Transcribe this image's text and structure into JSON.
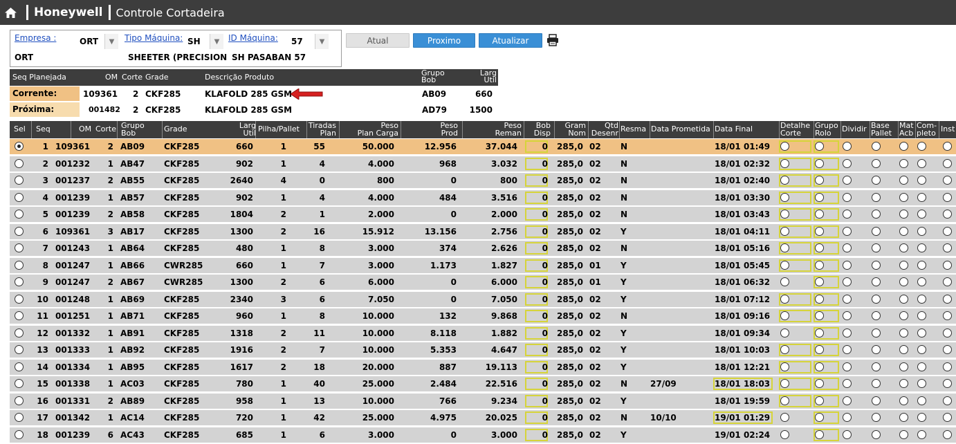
{
  "header": {
    "brand": "Honeywell",
    "title": "Controle Cortadeira"
  },
  "filters": {
    "empresa_label": "Empresa :",
    "empresa_value": "ORT",
    "empresa_text": "ORT",
    "tipo_label": "Tipo Máquina:",
    "tipo_value": "SH",
    "tipo_text": "SHEETER (PRECISION",
    "id_label": "ID Máquina:",
    "id_value": "57",
    "id_text": "SH PASABAN 57"
  },
  "buttons": {
    "atual": "Atual",
    "proximo": "Proximo",
    "atualizar": "Atualizar"
  },
  "info": {
    "headers": {
      "seq": "Seq Planejada",
      "om": "OM",
      "corte": "Corte",
      "grade": "Grade",
      "desc": "Descrição Produto",
      "grupo1": "Grupo",
      "grupo2": "Bob",
      "larg1": "Larg",
      "larg2": "Util"
    },
    "corrente": {
      "label": "Corrente:",
      "om": "109361",
      "corte": "2",
      "grade": "CKF285",
      "desc": "KLAFOLD 285 GSM",
      "grupo": "AB09",
      "larg": "660"
    },
    "proxima": {
      "label": "Próxima:",
      "om": "001482",
      "corte": "2",
      "grade": "CKF285",
      "desc": "KLAFOLD 285 GSM",
      "grupo": "AD79",
      "larg": "1500"
    }
  },
  "grid": {
    "headers": {
      "sel": "Sel",
      "seq": "Seq",
      "om": "OM",
      "corte": "Corte",
      "grupo1": "Grupo",
      "grupo2": "Bob",
      "grade": "Grade",
      "larg1": "Larg",
      "larg2": "Util",
      "pilha": "Pilha/Pallet",
      "tir1": "Tiradas",
      "tir2": "Plan",
      "pp1": "Peso",
      "pp2": "Plan Carga",
      "pprod1": "Peso",
      "pprod2": "Prod",
      "prem1": "Peso",
      "prem2": "Reman",
      "bob1": "Bob",
      "bob2": "Disp",
      "gram1": "Gram",
      "gram2": "Nom",
      "qtd1": "Qtd",
      "qtd2": "Desenr",
      "resma": "Resma",
      "dprom": "Data Prometida",
      "dfinal": "Data Final",
      "det1": "Detalhe",
      "det2": "Corte",
      "gr1": "Grupo",
      "gr2": "Rolo",
      "dividir": "Dividir",
      "base1": "Base",
      "base2": "Pallet",
      "mat1": "Mat",
      "mat2": "Acb",
      "comp1": "Com-",
      "comp2": "pleto",
      "inst": "Inst"
    },
    "rows": [
      {
        "seq": "1",
        "om": "109361",
        "corte": "2",
        "grupo": "AB09",
        "grade": "CKF285",
        "larg": "660",
        "pilha": "1",
        "tiradas": "55",
        "plan": "50.000",
        "prod": "12.956",
        "reman": "37.044",
        "bob": "0",
        "gram": "285,0",
        "qtd": "02",
        "resma": "N",
        "dprom": "",
        "dfinal": "18/01 01:49",
        "selected": true,
        "yb_final": false,
        "yb_det": true,
        "yb_grupo": true
      },
      {
        "seq": "2",
        "om": "001232",
        "corte": "1",
        "grupo": "AB47",
        "grade": "CKF285",
        "larg": "902",
        "pilha": "1",
        "tiradas": "4",
        "plan": "4.000",
        "prod": "968",
        "reman": "3.032",
        "bob": "0",
        "gram": "285,0",
        "qtd": "02",
        "resma": "N",
        "dprom": "",
        "dfinal": "18/01 02:32",
        "selected": false,
        "yb_final": false,
        "yb_det": true,
        "yb_grupo": true
      },
      {
        "seq": "3",
        "om": "001237",
        "corte": "2",
        "grupo": "AB55",
        "grade": "CKF285",
        "larg": "2640",
        "pilha": "4",
        "tiradas": "0",
        "plan": "800",
        "prod": "0",
        "reman": "800",
        "bob": "0",
        "gram": "285,0",
        "qtd": "02",
        "resma": "N",
        "dprom": "",
        "dfinal": "18/01 02:40",
        "selected": false,
        "yb_final": false,
        "yb_det": true,
        "yb_grupo": true
      },
      {
        "seq": "4",
        "om": "001239",
        "corte": "1",
        "grupo": "AB57",
        "grade": "CKF285",
        "larg": "902",
        "pilha": "1",
        "tiradas": "4",
        "plan": "4.000",
        "prod": "484",
        "reman": "3.516",
        "bob": "0",
        "gram": "285,0",
        "qtd": "02",
        "resma": "N",
        "dprom": "",
        "dfinal": "18/01 03:30",
        "selected": false,
        "yb_final": false,
        "yb_det": true,
        "yb_grupo": true
      },
      {
        "seq": "5",
        "om": "001239",
        "corte": "2",
        "grupo": "AB58",
        "grade": "CKF285",
        "larg": "1804",
        "pilha": "2",
        "tiradas": "1",
        "plan": "2.000",
        "prod": "0",
        "reman": "2.000",
        "bob": "0",
        "gram": "285,0",
        "qtd": "02",
        "resma": "N",
        "dprom": "",
        "dfinal": "18/01 03:43",
        "selected": false,
        "yb_final": false,
        "yb_det": true,
        "yb_grupo": true
      },
      {
        "seq": "6",
        "om": "109361",
        "corte": "3",
        "grupo": "AB17",
        "grade": "CKF285",
        "larg": "1300",
        "pilha": "2",
        "tiradas": "16",
        "plan": "15.912",
        "prod": "13.156",
        "reman": "2.756",
        "bob": "0",
        "gram": "285,0",
        "qtd": "02",
        "resma": "Y",
        "dprom": "",
        "dfinal": "18/01 04:11",
        "selected": false,
        "yb_final": false,
        "yb_det": true,
        "yb_grupo": true
      },
      {
        "seq": "7",
        "om": "001243",
        "corte": "1",
        "grupo": "AB64",
        "grade": "CKF285",
        "larg": "480",
        "pilha": "1",
        "tiradas": "8",
        "plan": "3.000",
        "prod": "374",
        "reman": "2.626",
        "bob": "0",
        "gram": "285,0",
        "qtd": "02",
        "resma": "N",
        "dprom": "",
        "dfinal": "18/01 05:16",
        "selected": false,
        "yb_final": false,
        "yb_det": true,
        "yb_grupo": true
      },
      {
        "seq": "8",
        "om": "001247",
        "corte": "1",
        "grupo": "AB66",
        "grade": "CWR285",
        "larg": "660",
        "pilha": "1",
        "tiradas": "7",
        "plan": "3.000",
        "prod": "1.173",
        "reman": "1.827",
        "bob": "0",
        "gram": "285,0",
        "qtd": "01",
        "resma": "Y",
        "dprom": "",
        "dfinal": "18/01 05:45",
        "selected": false,
        "yb_final": false,
        "yb_det": true,
        "yb_grupo": true
      },
      {
        "seq": "9",
        "om": "001247",
        "corte": "2",
        "grupo": "AB67",
        "grade": "CWR285",
        "larg": "1300",
        "pilha": "2",
        "tiradas": "6",
        "plan": "6.000",
        "prod": "0",
        "reman": "6.000",
        "bob": "0",
        "gram": "285,0",
        "qtd": "01",
        "resma": "Y",
        "dprom": "",
        "dfinal": "18/01 06:32",
        "selected": false,
        "yb_final": false,
        "yb_det": false,
        "yb_grupo": true
      },
      {
        "seq": "10",
        "om": "001248",
        "corte": "1",
        "grupo": "AB69",
        "grade": "CKF285",
        "larg": "2340",
        "pilha": "3",
        "tiradas": "6",
        "plan": "7.050",
        "prod": "0",
        "reman": "7.050",
        "bob": "0",
        "gram": "285,0",
        "qtd": "02",
        "resma": "Y",
        "dprom": "",
        "dfinal": "18/01 07:12",
        "selected": false,
        "yb_final": false,
        "yb_det": true,
        "yb_grupo": true
      },
      {
        "seq": "11",
        "om": "001251",
        "corte": "1",
        "grupo": "AB71",
        "grade": "CKF285",
        "larg": "960",
        "pilha": "1",
        "tiradas": "8",
        "plan": "10.000",
        "prod": "132",
        "reman": "9.868",
        "bob": "0",
        "gram": "285,0",
        "qtd": "02",
        "resma": "N",
        "dprom": "",
        "dfinal": "18/01 09:16",
        "selected": false,
        "yb_final": false,
        "yb_det": true,
        "yb_grupo": true
      },
      {
        "seq": "12",
        "om": "001332",
        "corte": "1",
        "grupo": "AB91",
        "grade": "CKF285",
        "larg": "1318",
        "pilha": "2",
        "tiradas": "11",
        "plan": "10.000",
        "prod": "8.118",
        "reman": "1.882",
        "bob": "0",
        "gram": "285,0",
        "qtd": "02",
        "resma": "Y",
        "dprom": "",
        "dfinal": "18/01 09:34",
        "selected": false,
        "yb_final": false,
        "yb_det": false,
        "yb_grupo": true
      },
      {
        "seq": "13",
        "om": "001333",
        "corte": "1",
        "grupo": "AB92",
        "grade": "CKF285",
        "larg": "1916",
        "pilha": "2",
        "tiradas": "7",
        "plan": "10.000",
        "prod": "5.353",
        "reman": "4.647",
        "bob": "0",
        "gram": "285,0",
        "qtd": "02",
        "resma": "Y",
        "dprom": "",
        "dfinal": "18/01 10:03",
        "selected": false,
        "yb_final": false,
        "yb_det": true,
        "yb_grupo": true
      },
      {
        "seq": "14",
        "om": "001334",
        "corte": "1",
        "grupo": "AB95",
        "grade": "CKF285",
        "larg": "1617",
        "pilha": "2",
        "tiradas": "18",
        "plan": "20.000",
        "prod": "887",
        "reman": "19.113",
        "bob": "0",
        "gram": "285,0",
        "qtd": "02",
        "resma": "Y",
        "dprom": "",
        "dfinal": "18/01 12:21",
        "selected": false,
        "yb_final": false,
        "yb_det": true,
        "yb_grupo": true
      },
      {
        "seq": "15",
        "om": "001338",
        "corte": "1",
        "grupo": "AC03",
        "grade": "CKF285",
        "larg": "780",
        "pilha": "1",
        "tiradas": "40",
        "plan": "25.000",
        "prod": "2.484",
        "reman": "22.516",
        "bob": "0",
        "gram": "285,0",
        "qtd": "02",
        "resma": "N",
        "dprom": "27/09",
        "dfinal": "18/01 18:03",
        "selected": false,
        "yb_final": true,
        "yb_det": true,
        "yb_grupo": true
      },
      {
        "seq": "16",
        "om": "001331",
        "corte": "2",
        "grupo": "AB89",
        "grade": "CKF285",
        "larg": "958",
        "pilha": "1",
        "tiradas": "13",
        "plan": "10.000",
        "prod": "766",
        "reman": "9.234",
        "bob": "0",
        "gram": "285,0",
        "qtd": "02",
        "resma": "Y",
        "dprom": "",
        "dfinal": "18/01 19:59",
        "selected": false,
        "yb_final": false,
        "yb_det": true,
        "yb_grupo": true
      },
      {
        "seq": "17",
        "om": "001342",
        "corte": "1",
        "grupo": "AC14",
        "grade": "CKF285",
        "larg": "720",
        "pilha": "1",
        "tiradas": "42",
        "plan": "25.000",
        "prod": "4.975",
        "reman": "20.025",
        "bob": "0",
        "gram": "285,0",
        "qtd": "02",
        "resma": "N",
        "dprom": "10/10",
        "dfinal": "19/01 01:29",
        "selected": false,
        "yb_final": true,
        "yb_det": false,
        "yb_grupo": true
      },
      {
        "seq": "18",
        "om": "001239",
        "corte": "6",
        "grupo": "AC43",
        "grade": "CKF285",
        "larg": "685",
        "pilha": "1",
        "tiradas": "6",
        "plan": "3.000",
        "prod": "0",
        "reman": "3.000",
        "bob": "0",
        "gram": "285,0",
        "qtd": "02",
        "resma": "Y",
        "dprom": "",
        "dfinal": "19/01 02:24",
        "selected": false,
        "yb_final": false,
        "yb_det": false,
        "yb_grupo": true
      }
    ]
  }
}
